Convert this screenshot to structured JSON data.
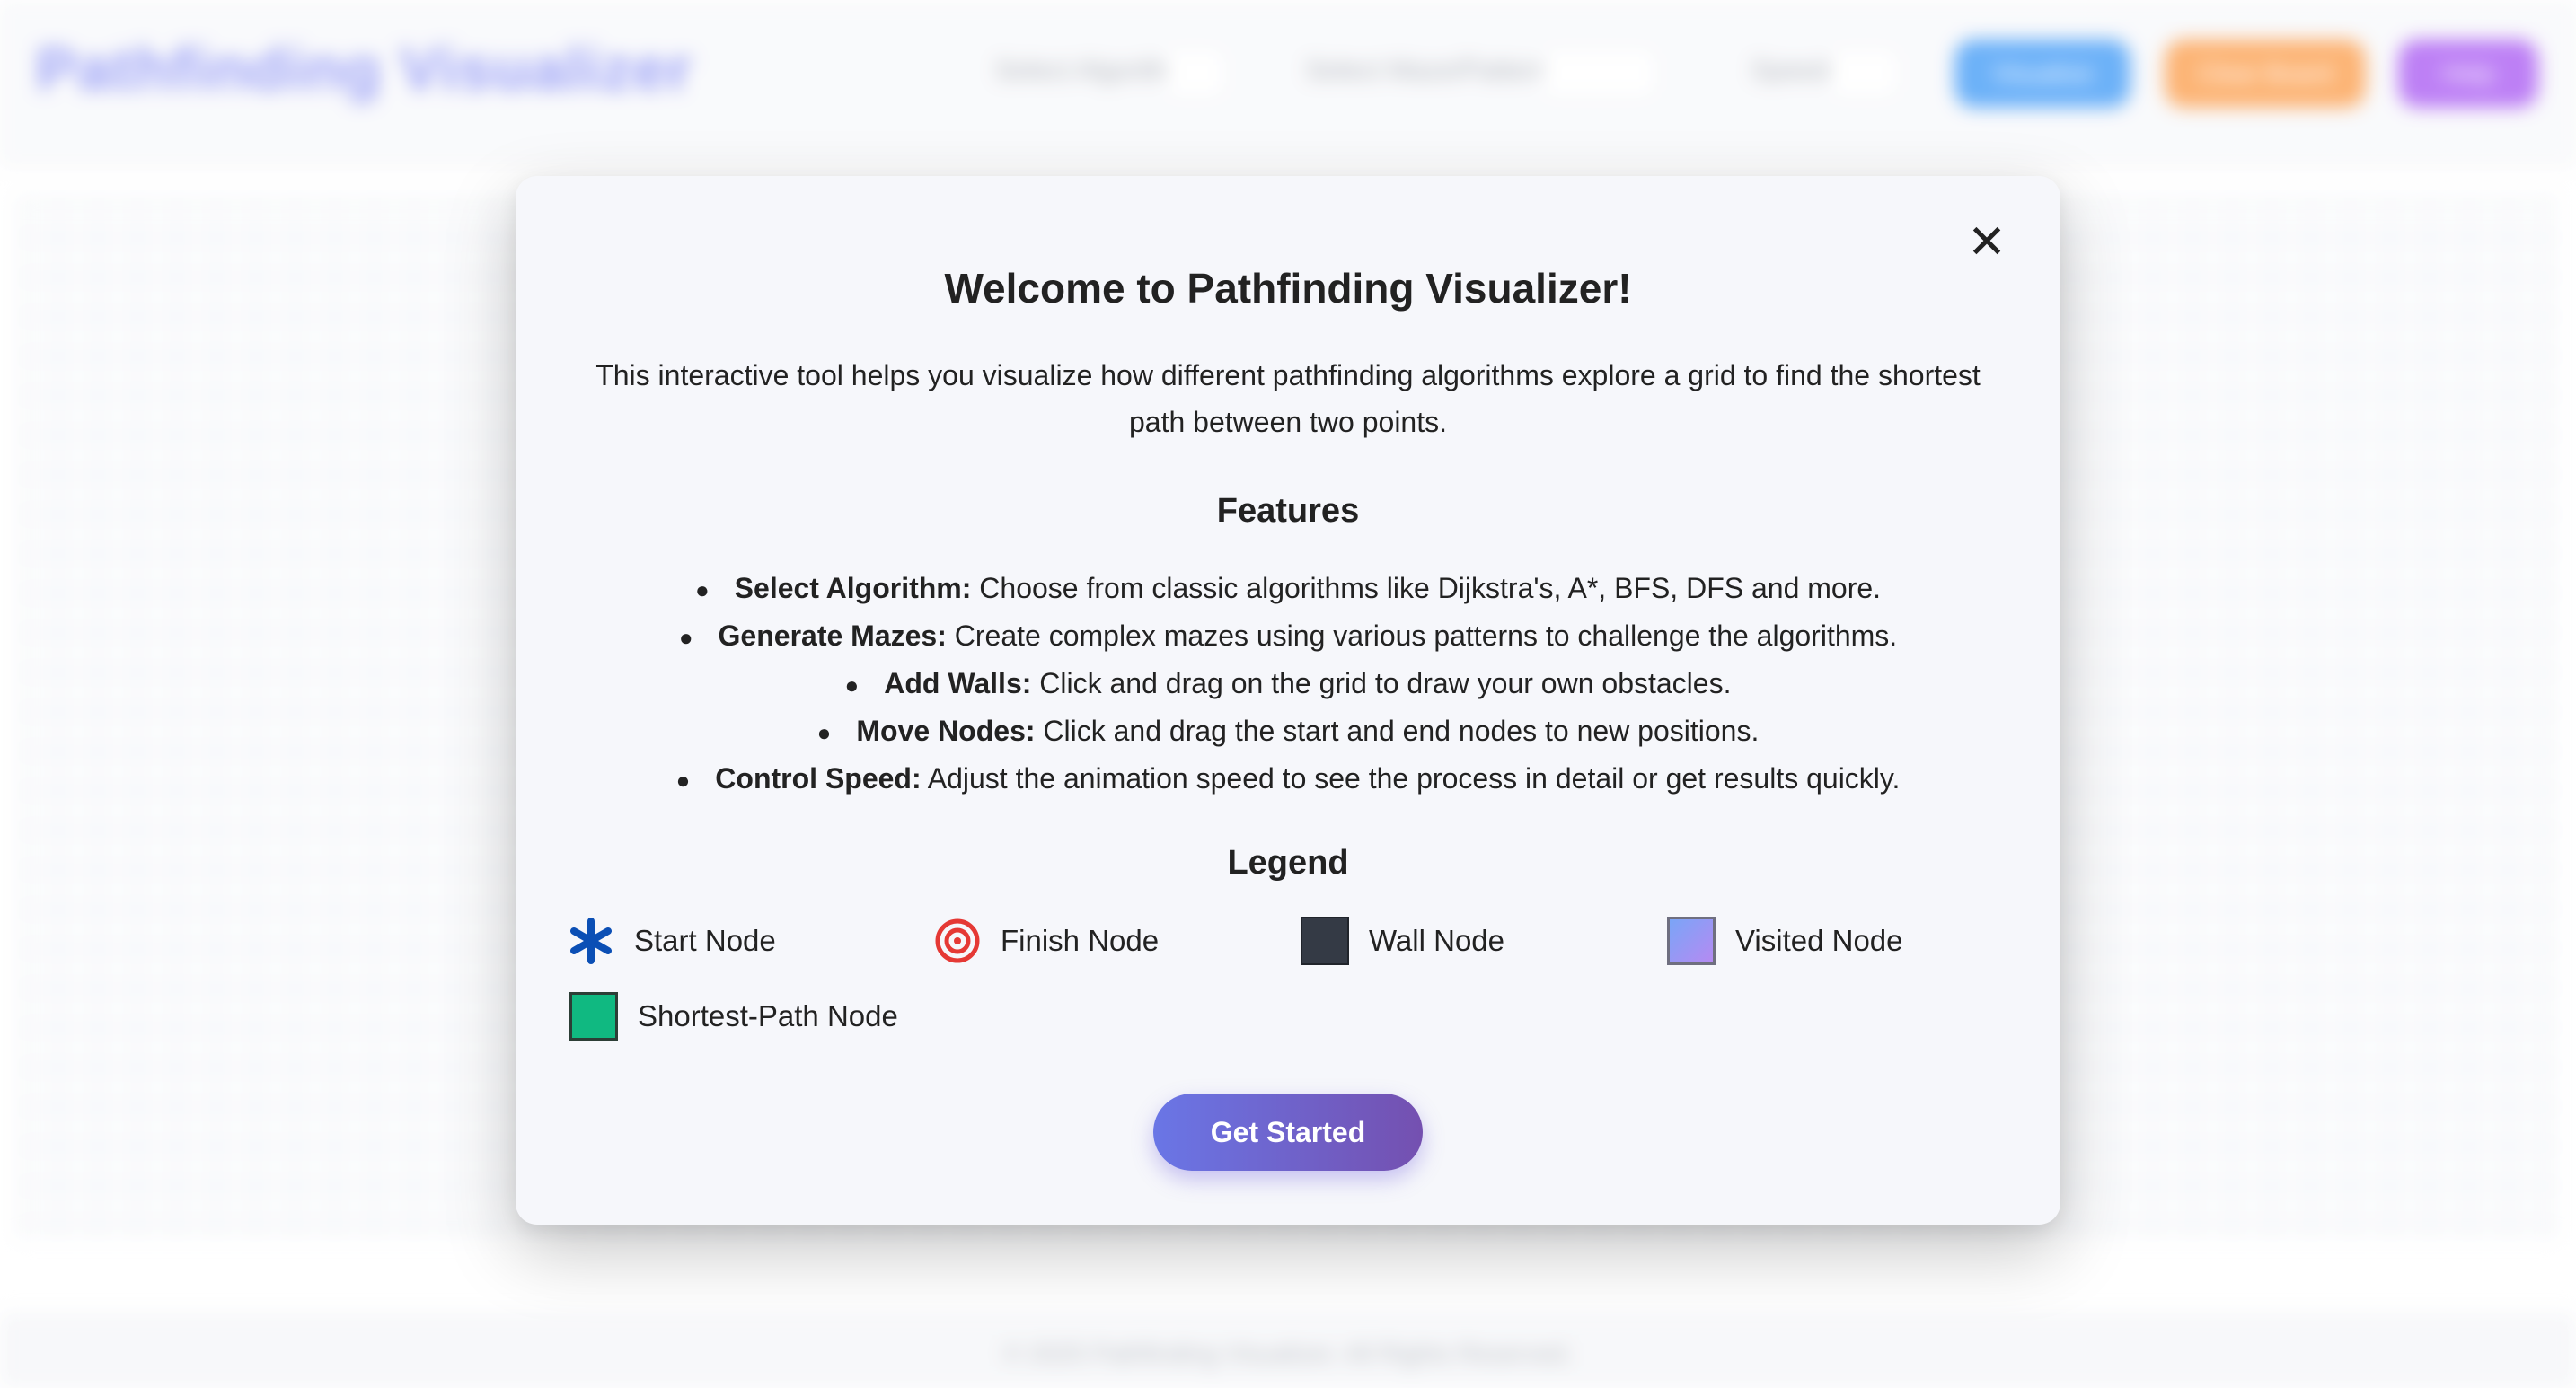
{
  "app": {
    "title": "Pathfinding Visualizer",
    "controls": [
      "Select Algorithm",
      "Select Maze/Pattern",
      "Speed"
    ],
    "buttons": [
      {
        "label": "Visualize",
        "color": "#1e88f5"
      },
      {
        "label": "Clear Board",
        "color": "#fb8c2b"
      },
      {
        "label": "Help",
        "color": "#9a3cf0"
      }
    ],
    "footer": "© 2025 Pathfinding Visualizer. All Rights Reserved."
  },
  "modal": {
    "close_label": "✕",
    "title": "Welcome to Pathfinding Visualizer!",
    "intro": "This interactive tool helps you visualize how different pathfinding algorithms explore a grid to find the shortest path between two points.",
    "features_title": "Features",
    "features": [
      {
        "bold": "Select Algorithm:",
        "text": " Choose from classic algorithms like Dijkstra's, A*, BFS, DFS and more."
      },
      {
        "bold": "Generate Mazes:",
        "text": " Create complex mazes using various patterns to challenge the algorithms."
      },
      {
        "bold": "Add Walls:",
        "text": " Click and drag on the grid to draw your own obstacles."
      },
      {
        "bold": "Move Nodes:",
        "text": " Click and drag the start and end nodes to new positions."
      },
      {
        "bold": "Control Speed:",
        "text": " Adjust the animation speed to see the process in detail or get results quickly."
      }
    ],
    "legend_title": "Legend",
    "legend": [
      {
        "label": "Start Node",
        "icon": "asterisk-icon",
        "color": "#0b4fb5"
      },
      {
        "label": "Finish Node",
        "icon": "target-icon",
        "color": "#e53935"
      },
      {
        "label": "Wall Node",
        "icon": "wall-swatch",
        "color": "#343a45"
      },
      {
        "label": "Visited Node",
        "icon": "visited-swatch",
        "color": "#9a98f3"
      },
      {
        "label": "Shortest-Path Node",
        "icon": "path-swatch",
        "color": "#10b981"
      }
    ],
    "cta": "Get Started"
  }
}
